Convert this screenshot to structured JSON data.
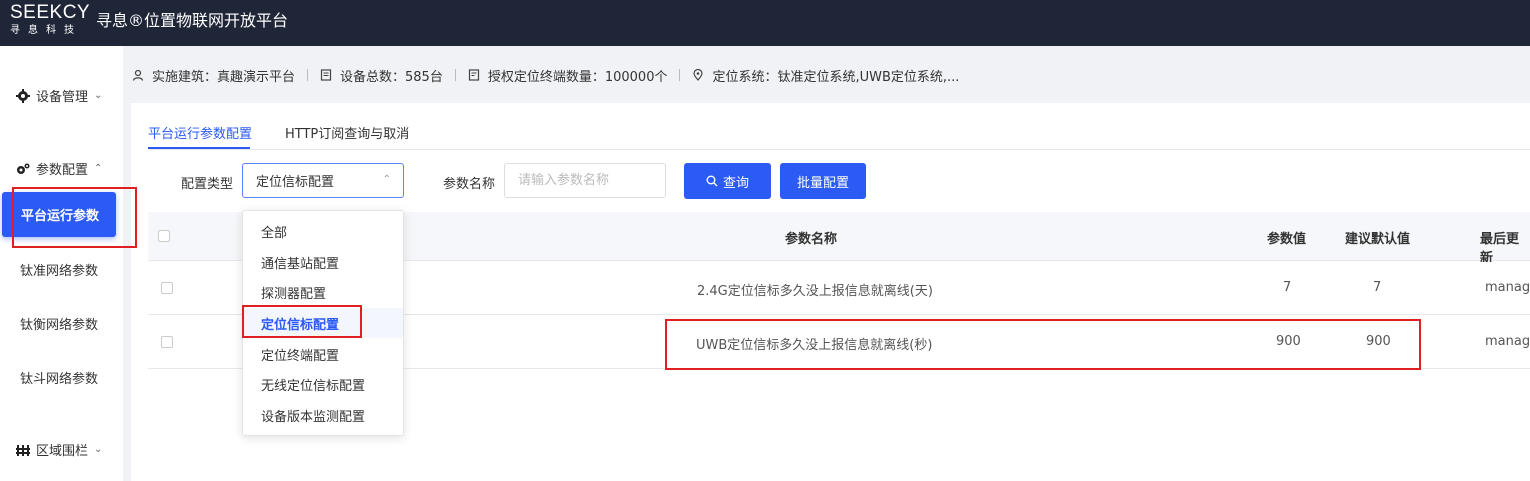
{
  "brand": {
    "logo_text": "SEEKCY",
    "logo_sub": "寻息科技",
    "title": "寻息®位置物联网开放平台"
  },
  "sidebar": {
    "groups": [
      {
        "label": "设备管理",
        "icon": "gear-icon"
      },
      {
        "label": "参数配置",
        "icon": "gears-icon"
      },
      {
        "label": "区域围栏",
        "icon": "fence-icon"
      }
    ],
    "sub_items": [
      "平台运行参数",
      "钛准网络参数",
      "钛衡网络参数",
      "钛斗网络参数"
    ],
    "active_index": 0
  },
  "infobar": {
    "building": "实施建筑：真趣演示平台",
    "device_total": "设备总数：585台",
    "authorized": "授权定位终端数量：100000个",
    "positioning": "定位系统：钛准定位系统,UWB定位系统,..."
  },
  "tabs": [
    "平台运行参数配置",
    "HTTP订阅查询与取消"
  ],
  "filters": {
    "type_label": "配置类型",
    "type_value": "定位信标配置",
    "name_label": "参数名称",
    "name_placeholder": "请输入参数名称",
    "search_label": "查询",
    "batch_label": "批量配置"
  },
  "table": {
    "headers": {
      "name": "参数名称",
      "value": "参数值",
      "default": "建议默认值",
      "updated": "最后更新"
    },
    "rows": [
      {
        "name": "2.4G定位信标多久没上报信息就离线(天)",
        "value": "7",
        "default": "7",
        "updated": "manage"
      },
      {
        "name": "UWB定位信标多久没上报信息就离线(秒)",
        "value": "900",
        "default": "900",
        "updated": "manage"
      }
    ]
  },
  "dropdown": {
    "options": [
      "全部",
      "通信基站配置",
      "探测器配置",
      "定位信标配置",
      "定位终端配置",
      "无线定位信标配置",
      "设备版本监测配置"
    ],
    "selected_index": 3
  },
  "colors": {
    "primary": "#2c5af5",
    "topbar": "#1f2638",
    "annotation": "#e02020"
  }
}
